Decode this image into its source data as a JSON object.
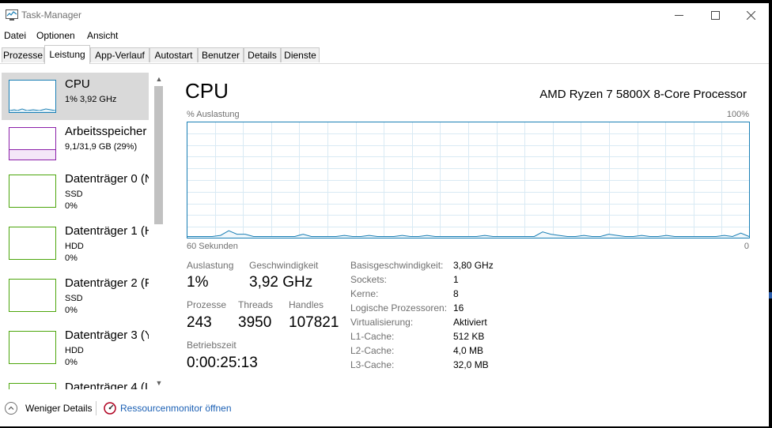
{
  "window": {
    "title": "Task-Manager"
  },
  "menu": [
    "Datei",
    "Optionen",
    "Ansicht"
  ],
  "tabs": [
    {
      "label": "Prozesse",
      "active": false
    },
    {
      "label": "Leistung",
      "active": true
    },
    {
      "label": "App-Verlauf",
      "active": false
    },
    {
      "label": "Autostart",
      "active": false
    },
    {
      "label": "Benutzer",
      "active": false
    },
    {
      "label": "Details",
      "active": false
    },
    {
      "label": "Dienste",
      "active": false
    }
  ],
  "sidebar": {
    "items": [
      {
        "name": "CPU",
        "lines": [
          "1% 3,92 GHz"
        ],
        "color": "#1a7fb5",
        "selected": true
      },
      {
        "name": "Arbeitsspeicher",
        "lines": [
          "9,1/31,9 GB (29%)"
        ],
        "color": "#8b1fa9",
        "selected": false
      },
      {
        "name": "Datenträger 0 (N",
        "lines": [
          "SSD",
          "0%"
        ],
        "color": "#4da60c",
        "selected": false
      },
      {
        "name": "Datenträger 1 (H",
        "lines": [
          "HDD",
          "0%"
        ],
        "color": "#4da60c",
        "selected": false
      },
      {
        "name": "Datenträger 2 (F",
        "lines": [
          "SSD",
          "0%"
        ],
        "color": "#4da60c",
        "selected": false
      },
      {
        "name": "Datenträger 3 (Y",
        "lines": [
          "HDD",
          "0%"
        ],
        "color": "#4da60c",
        "selected": false
      },
      {
        "name": "Datenträger 4 (I",
        "lines": [],
        "color": "#4da60c",
        "selected": false
      }
    ]
  },
  "main": {
    "title": "CPU",
    "processor": "AMD Ryzen 7 5800X 8-Core Processor",
    "chart_top_left": "% Auslastung",
    "chart_top_right": "100%",
    "chart_bottom_left": "60 Sekunden",
    "chart_bottom_right": "0",
    "stats": {
      "util_label": "Auslastung",
      "util_value": "1%",
      "speed_label": "Geschwindigkeit",
      "speed_value": "3,92 GHz",
      "proc_label": "Prozesse",
      "proc_value": "243",
      "threads_label": "Threads",
      "threads_value": "3950",
      "handles_label": "Handles",
      "handles_value": "107821",
      "uptime_label": "Betriebszeit",
      "uptime_value": "0:00:25:13"
    },
    "info": [
      {
        "label": "Basisgeschwindigkeit:",
        "value": "3,80 GHz"
      },
      {
        "label": "Sockets:",
        "value": "1"
      },
      {
        "label": "Kerne:",
        "value": "8"
      },
      {
        "label": "Logische Prozessoren:",
        "value": "16"
      },
      {
        "label": "Virtualisierung:",
        "value": "Aktiviert"
      },
      {
        "label": "L1-Cache:",
        "value": "512 KB"
      },
      {
        "label": "L2-Cache:",
        "value": "4,0 MB"
      },
      {
        "label": "L3-Cache:",
        "value": "32,0 MB"
      }
    ]
  },
  "footer": {
    "fewer_details": "Weniger Details",
    "resource_monitor": "Ressourcenmonitor öffnen"
  },
  "chart_data": {
    "type": "line",
    "x": [
      60,
      58,
      56,
      54,
      52,
      50,
      48,
      46,
      44,
      42,
      40,
      38,
      36,
      34,
      32,
      30,
      28,
      26,
      24,
      22,
      20,
      18,
      16,
      14,
      12,
      10,
      8,
      6,
      4,
      2,
      0
    ],
    "values": [
      1,
      1,
      1,
      1,
      2,
      6,
      3,
      3,
      1,
      1,
      1,
      1,
      1,
      1,
      3,
      1,
      1,
      1,
      1,
      2,
      1,
      1,
      2,
      1,
      1,
      1,
      2,
      1,
      1,
      2,
      1,
      1,
      1,
      1,
      1,
      1,
      2,
      1,
      1,
      1,
      1,
      1,
      1,
      5,
      3,
      2,
      1,
      1,
      2,
      1,
      1,
      3,
      2,
      1,
      1,
      2,
      1,
      1,
      2,
      1,
      1,
      1,
      1,
      1,
      1,
      2,
      1,
      4,
      1
    ],
    "ylim": [
      0,
      100
    ],
    "xlabel": "60 Sekunden",
    "ylabel": "% Auslastung",
    "color": "#1a7fb5",
    "grid": true
  }
}
